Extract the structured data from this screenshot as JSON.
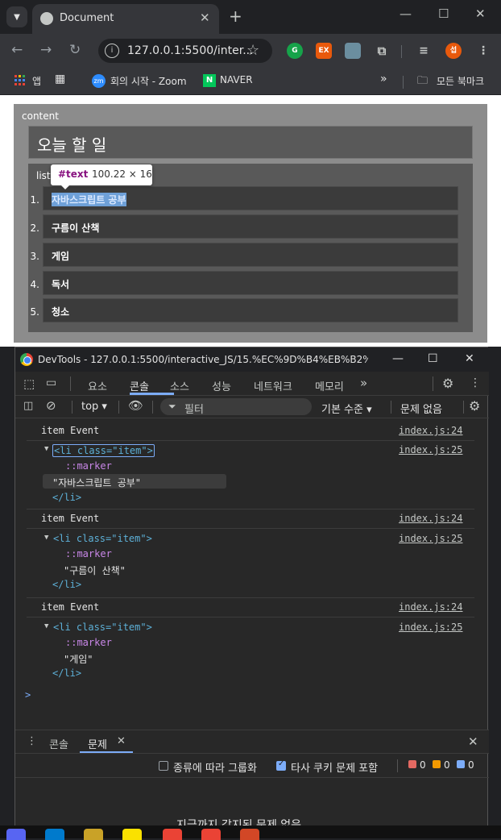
{
  "browser": {
    "tab_title": "Document",
    "tab_close": "✕",
    "new_tab": "+",
    "url": "127.0.0.1:5500/inter...",
    "window_controls": {
      "minimize": "—",
      "maximize": "☐",
      "close": "✕"
    },
    "profile_initial": "섭",
    "ext_labels": [
      "G",
      "EX"
    ],
    "bookmarks": [
      {
        "label": "앱",
        "icon": "apps-grid-icon"
      },
      {
        "label": "",
        "icon": "tab-groups-icon"
      },
      {
        "label": "회의 시작 - Zoom",
        "icon": "zoom-icon",
        "badge": "zm"
      },
      {
        "label": "NAVER",
        "icon": "naver-icon",
        "badge": "N"
      }
    ],
    "bookmarks_overflow": "»",
    "all_bookmarks": "모든 북마크"
  },
  "page": {
    "content_label": "content",
    "title": "오늘 할 일",
    "list_label": "list",
    "items": [
      {
        "num": "1.",
        "text": "자바스크립트 공부"
      },
      {
        "num": "2.",
        "text": "구름이 산책"
      },
      {
        "num": "3.",
        "text": "게임"
      },
      {
        "num": "4.",
        "text": "독서"
      },
      {
        "num": "5.",
        "text": "청소"
      }
    ],
    "tooltip": {
      "tag": "#text",
      "dims": "100.22 × 16"
    }
  },
  "devtools": {
    "title": "DevTools - 127.0.0.1:5500/interactive_JS/15.%EC%9D%B4%EB%B2%A4%ED%...",
    "tabs": [
      "요소",
      "콘솔",
      "소스",
      "성능",
      "네트워크",
      "메모리"
    ],
    "active_tab": "콘솔",
    "more_tabs": "»",
    "context": "top ▾",
    "filter_placeholder": "필터",
    "level": "기본 수준 ▾",
    "issues": "문제 없음",
    "logs": [
      {
        "event": "item Event",
        "src1": "index.js:24",
        "tag_open": "<li class=\"item\">",
        "src2": "index.js:25",
        "marker": "::marker",
        "text": "\"자바스크립트 공부\"",
        "tag_close": "</li>"
      },
      {
        "event": "item Event",
        "src1": "index.js:24",
        "tag_open": "<li class=\"item\">",
        "src2": "index.js:25",
        "marker": "::marker",
        "text": "\"구름이 산책\"",
        "tag_close": "</li>"
      },
      {
        "event": "item Event",
        "src1": "index.js:24",
        "tag_open": "<li class=\"item\">",
        "src2": "index.js:25",
        "marker": "::marker",
        "text": "\"게임\"",
        "tag_close": "</li>"
      }
    ],
    "prompt": ">",
    "drawer": {
      "tabs": [
        "콘솔",
        "문제"
      ],
      "active": "문제",
      "group_by_kind": "종류에 따라 그룹화",
      "include_third_party": "타사 쿠키 문제 포함",
      "counts": [
        "0",
        "0",
        "0"
      ],
      "empty_message": "지금까지 감지된 문제 없음"
    }
  },
  "colors": {
    "accent": "#7cacf8",
    "content_bg": "#8c8c8c",
    "box_bg": "#595959",
    "item_bg": "#3b3b3b"
  }
}
